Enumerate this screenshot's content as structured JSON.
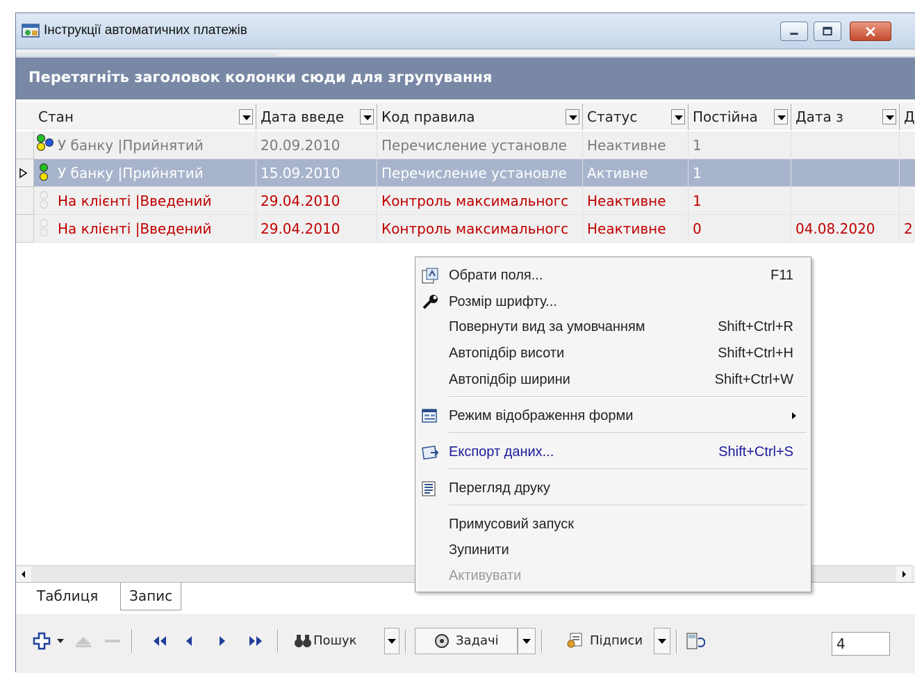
{
  "window": {
    "title": "Інструкції автоматичних платежів",
    "group_hint": "Перетягніть заголовок колонки сюди для згрупування"
  },
  "columns": [
    {
      "label": "Стан"
    },
    {
      "label": "Дата введе"
    },
    {
      "label": "Код правила"
    },
    {
      "label": "Статус"
    },
    {
      "label": "Постійна"
    },
    {
      "label": "Дата з"
    },
    {
      "label": "Д"
    }
  ],
  "rows": [
    {
      "state": "У банку |Прийнятий",
      "date": "20.09.2010",
      "rule": "Перечисление установле",
      "status": "Неактивне",
      "constant": "1",
      "date_from": "",
      "extra": "",
      "style": "gray"
    },
    {
      "state": "У банку |Прийнятий",
      "date": "15.09.2010",
      "rule": "Перечисление установле",
      "status": "Активне",
      "constant": "1",
      "date_from": "",
      "extra": "",
      "style": "sel"
    },
    {
      "state": "На клієнті |Введений",
      "date": "29.04.2010",
      "rule": "Контроль максимальногс",
      "status": "Неактивне",
      "constant": "1",
      "date_from": "",
      "extra": "",
      "style": "red"
    },
    {
      "state": "На клієнті |Введений",
      "date": "29.04.2010",
      "rule": "Контроль максимальногс",
      "status": "Неактивне",
      "constant": "0",
      "date_from": "04.08.2020",
      "extra": "2",
      "style": "red"
    }
  ],
  "tabs": {
    "table": "Таблиця",
    "record": "Запис"
  },
  "toolbar": {
    "search": "Пошук",
    "tasks": "Задачі",
    "signatures": "Підписи",
    "count": "4"
  },
  "context_menu": {
    "choose_fields": "Обрати поля...",
    "choose_fields_sc": "F11",
    "font_size": "Розмір шрифту...",
    "reset_view": "Повернути вид за умовчанням",
    "reset_view_sc": "Shift+Ctrl+R",
    "auto_height": "Автопідбір висоти",
    "auto_height_sc": "Shift+Ctrl+H",
    "auto_width": "Автопідбір ширини",
    "auto_width_sc": "Shift+Ctrl+W",
    "form_mode": "Режим відображення форми",
    "export": "Експорт даних...",
    "export_sc": "Shift+Ctrl+S",
    "print_preview": "Перегляд друку",
    "force_run": "Примусовий запуск",
    "stop": "Зупинити",
    "activate": "Активувати"
  },
  "colors": {
    "group_bar": "#7888a5",
    "selected_row": "#a8b4cc",
    "red_text": "#c00000"
  }
}
